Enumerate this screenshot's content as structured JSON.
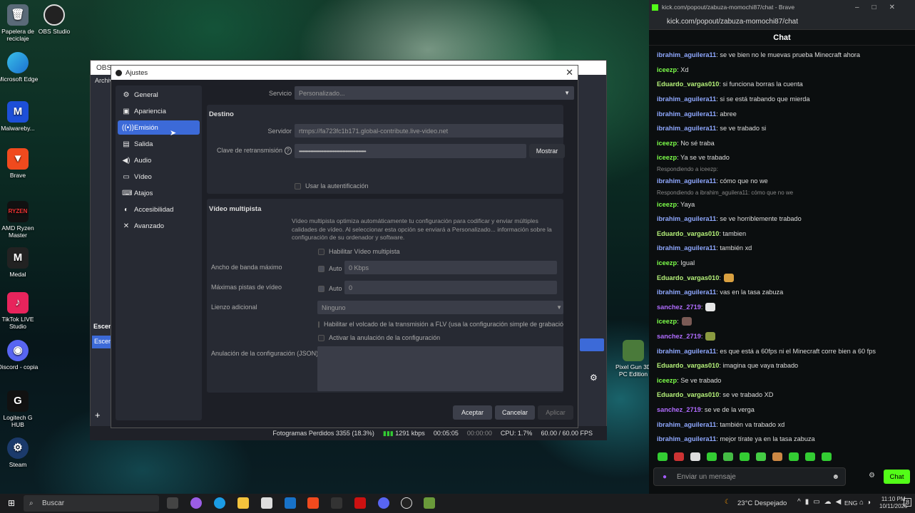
{
  "desktop": {
    "icons": [
      {
        "label": "Papelera de reciclaje",
        "icon": "recycle-bin-icon"
      },
      {
        "label": "OBS Studio",
        "icon": "obs-icon"
      },
      {
        "label": "Microsoft Edge",
        "icon": "edge-icon"
      },
      {
        "label": "Malwareby...",
        "icon": "malwarebytes-icon"
      },
      {
        "label": "Brave",
        "icon": "brave-icon"
      },
      {
        "label": "AMD Ryzen Master",
        "icon": "ryzen-icon"
      },
      {
        "label": "Medal",
        "icon": "medal-icon"
      },
      {
        "label": "TikTok LIVE Studio",
        "icon": "tiktok-icon"
      },
      {
        "label": "Discord - copia",
        "icon": "discord-icon"
      },
      {
        "label": "Logitech G HUB",
        "icon": "logitech-icon"
      },
      {
        "label": "Steam",
        "icon": "steam-icon"
      },
      {
        "label": "Pixel Gun 3D PC Edition",
        "icon": "pixelgun-icon"
      }
    ]
  },
  "obs_main": {
    "title": "OBS",
    "menu_archivo": "Archivo",
    "scenes_header": "Escen",
    "scene_item": "Escen",
    "status": {
      "dropped": "Fotogramas Perdidos 3355 (18.3%)",
      "kbps": "1291 kbps",
      "time1": "00:05:05",
      "time2": "00:00:00",
      "cpu": "CPU: 1.7%",
      "fps": "60.00 / 60.00 FPS"
    }
  },
  "ajustes": {
    "title": "Ajustes",
    "sidebar": [
      {
        "label": "General",
        "icon": "gear-icon"
      },
      {
        "label": "Apariencia",
        "icon": "appearance-icon"
      },
      {
        "label": "Emisión",
        "icon": "broadcast-icon"
      },
      {
        "label": "Salida",
        "icon": "output-icon"
      },
      {
        "label": "Audio",
        "icon": "speaker-icon"
      },
      {
        "label": "Vídeo",
        "icon": "monitor-icon"
      },
      {
        "label": "Atajos",
        "icon": "keyboard-icon"
      },
      {
        "label": "Accesibilidad",
        "icon": "accessibility-icon"
      },
      {
        "label": "Avanzado",
        "icon": "tools-icon"
      }
    ],
    "servicio_label": "Servicio",
    "servicio_value": "Personalizado...",
    "destino_header": "Destino",
    "servidor_label": "Servidor",
    "servidor_value": "rtmps://fa723fc1b171.global-contribute.live-video.net",
    "clave_label": "Clave de retransmisión",
    "clave_value": "••••••••••••••••••••••••••••••••••••••••••••••••••••",
    "mostrar": "Mostrar",
    "auth_label": "Usar la autentificación",
    "multi_header": "Vídeo multipista",
    "multi_desc": "Vídeo multipista optimiza automáticamente tu configuración para codificar y enviar múltiples calidades de vídeo. Al seleccionar esta opción se enviará a Personalizado... información sobre la configuración de su ordenador y software.",
    "habilitar_multi": "Habilitar Vídeo multipista",
    "ancho_label": "Ancho de banda máximo",
    "auto": "Auto",
    "ancho_value": "0 Kbps",
    "pistas_label": "Máximas pistas de vídeo",
    "pistas_value": "0",
    "lienzo_label": "Lienzo adicional",
    "lienzo_value": "Ninguno",
    "volcado_label": "Habilitar el volcado de la transmisión a FLV (usa la configuración simple de grabació",
    "anulacion_cb": "Activar la anulación de la configuración",
    "anulacion_label": "Anulación de la configuración (JSON)",
    "aceptar": "Aceptar",
    "cancelar": "Cancelar",
    "aplicar": "Aplicar"
  },
  "chat": {
    "window_title": "kick.com/popout/zabuza-momochi87/chat - Brave",
    "url": "kick.com/popout/zabuza-momochi87/chat",
    "header": "Chat",
    "messages": [
      {
        "user": "ibrahim_aguilera11",
        "text": ": se ve bien no le muevas prueba Minecraft ahora",
        "color": "#8fa8ff"
      },
      {
        "user": "iceezp",
        "text": ": Xd",
        "color": "#7dff4a"
      },
      {
        "user": "Eduardo_vargas010",
        "text": ": si funciona borras la cuenta",
        "color": "#b6f27a"
      },
      {
        "user": "ibrahim_aguilera11",
        "text": ": si se está trabando que mierda",
        "color": "#8fa8ff"
      },
      {
        "user": "ibrahim_aguilera11",
        "text": ": abree",
        "color": "#8fa8ff"
      },
      {
        "user": "ibrahim_aguilera11",
        "text": ": se ve trabado si",
        "color": "#8fa8ff"
      },
      {
        "user": "iceezp",
        "text": ": No sé traba",
        "color": "#7dff4a"
      },
      {
        "user": "iceezp",
        "text": ": Ya se ve trabado",
        "color": "#7dff4a"
      },
      {
        "reply": "Respondiendo a iceezp:"
      },
      {
        "user": "ibrahim_aguilera11",
        "text": ": cómo que no we",
        "color": "#8fa8ff"
      },
      {
        "reply": "Respondiendo a ibrahim_aguilera11: cómo que no we"
      },
      {
        "user": "iceezp",
        "text": ": Yaya",
        "color": "#7dff4a"
      },
      {
        "user": "ibrahim_aguilera11",
        "text": ": se ve horriblemente trabado",
        "color": "#8fa8ff"
      },
      {
        "user": "Eduardo_vargas010",
        "text": ": tambien",
        "color": "#b6f27a"
      },
      {
        "user": "ibrahim_aguilera11",
        "text": ": también xd",
        "color": "#8fa8ff"
      },
      {
        "user": "iceezp",
        "text": ": Igual",
        "color": "#7dff4a"
      },
      {
        "user": "Eduardo_vargas010",
        "text": ":",
        "color": "#b6f27a",
        "emote": "#d9a040"
      },
      {
        "user": "ibrahim_aguilera11",
        "text": ": vas en la tasa zabuza",
        "color": "#8fa8ff"
      },
      {
        "user": "sanchez_2719",
        "text": ":",
        "color": "#b06cff",
        "emote": "#e6e6e6"
      },
      {
        "user": "iceezp",
        "text": ":",
        "color": "#7dff4a",
        "emote": "#7a5a55"
      },
      {
        "user": "sanchez_2719",
        "text": ":",
        "color": "#b06cff",
        "emote": "#8a9a40"
      },
      {
        "user": "ibrahim_aguilera11",
        "text": ": es que está a 60fps ni el Minecraft corre bien a 60 fps",
        "color": "#8fa8ff"
      },
      {
        "user": "Eduardo_vargas010",
        "text": ": imagina que vaya trabado",
        "color": "#b6f27a"
      },
      {
        "user": "iceezp",
        "text": ": Se ve trabado",
        "color": "#7dff4a"
      },
      {
        "user": "Eduardo_vargas010",
        "text": ": se ve trabado XD",
        "color": "#b6f27a"
      },
      {
        "user": "sanchez_2719",
        "text": ": se ve de la verga",
        "color": "#b06cff"
      },
      {
        "user": "ibrahim_aguilera11",
        "text": ": también va trabado xd",
        "color": "#8fa8ff"
      },
      {
        "user": "ibrahim_aguilera11",
        "text": ": mejor tírate ya en la tasa zabuza",
        "color": "#8fa8ff"
      }
    ],
    "input_placeholder": "Enviar un mensaje",
    "send_label": "Chat"
  },
  "taskbar": {
    "search_placeholder": "Buscar",
    "weather": "23°C  Despejado",
    "lang": "ENG",
    "time": "11:10 PM",
    "date": "10/11/2025",
    "notif_count": "8"
  }
}
